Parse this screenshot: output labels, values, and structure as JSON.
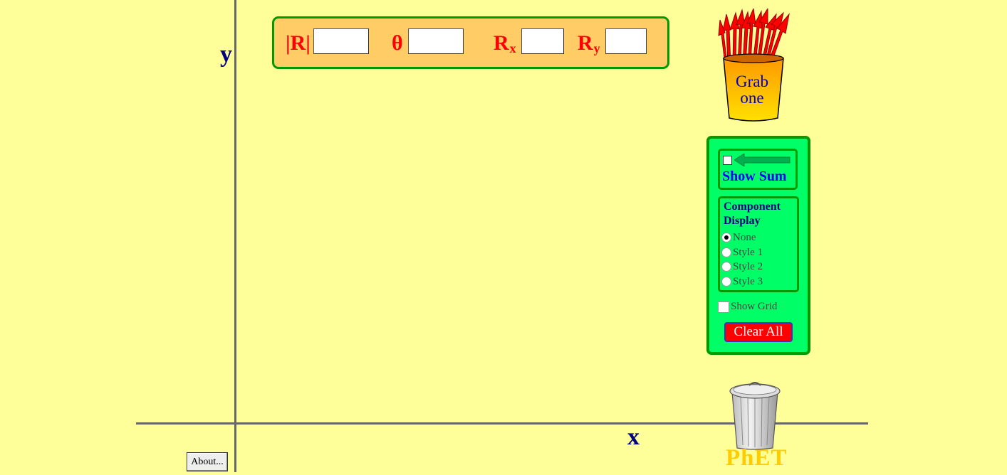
{
  "axes": {
    "y_label": "y",
    "x_label": "x"
  },
  "readout": {
    "magnitude_label": "|R|",
    "theta_label": "θ",
    "rx_label": "R",
    "rx_sub": "x",
    "ry_label": "R",
    "ry_sub": "y",
    "magnitude_value": "",
    "theta_value": "",
    "rx_value": "",
    "ry_value": ""
  },
  "vector_bin": {
    "line1": "Grab",
    "line2": "one",
    "icon": "vector-bucket-icon"
  },
  "controls": {
    "show_sum_label": "Show Sum",
    "show_sum_checked": false,
    "component_title_line1": "Component",
    "component_title_line2": "Display",
    "component_options": [
      "None",
      "Style 1",
      "Style 2",
      "Style 3"
    ],
    "component_selected": "None",
    "show_grid_label": "Show Grid",
    "show_grid_checked": false,
    "clear_label": "Clear All"
  },
  "trash": {
    "icon": "trash-can-icon"
  },
  "about_label": "About...",
  "logo_text": "PhET",
  "colors": {
    "background": "#FFFF99",
    "readout_bg": "#FFCC66",
    "panel_bg": "#00FF66",
    "panel_border": "#009900",
    "readout_label": "#FF0000",
    "axis_label": "#000080",
    "clear_button": "#FF0000",
    "logo": "#FFCC00"
  }
}
